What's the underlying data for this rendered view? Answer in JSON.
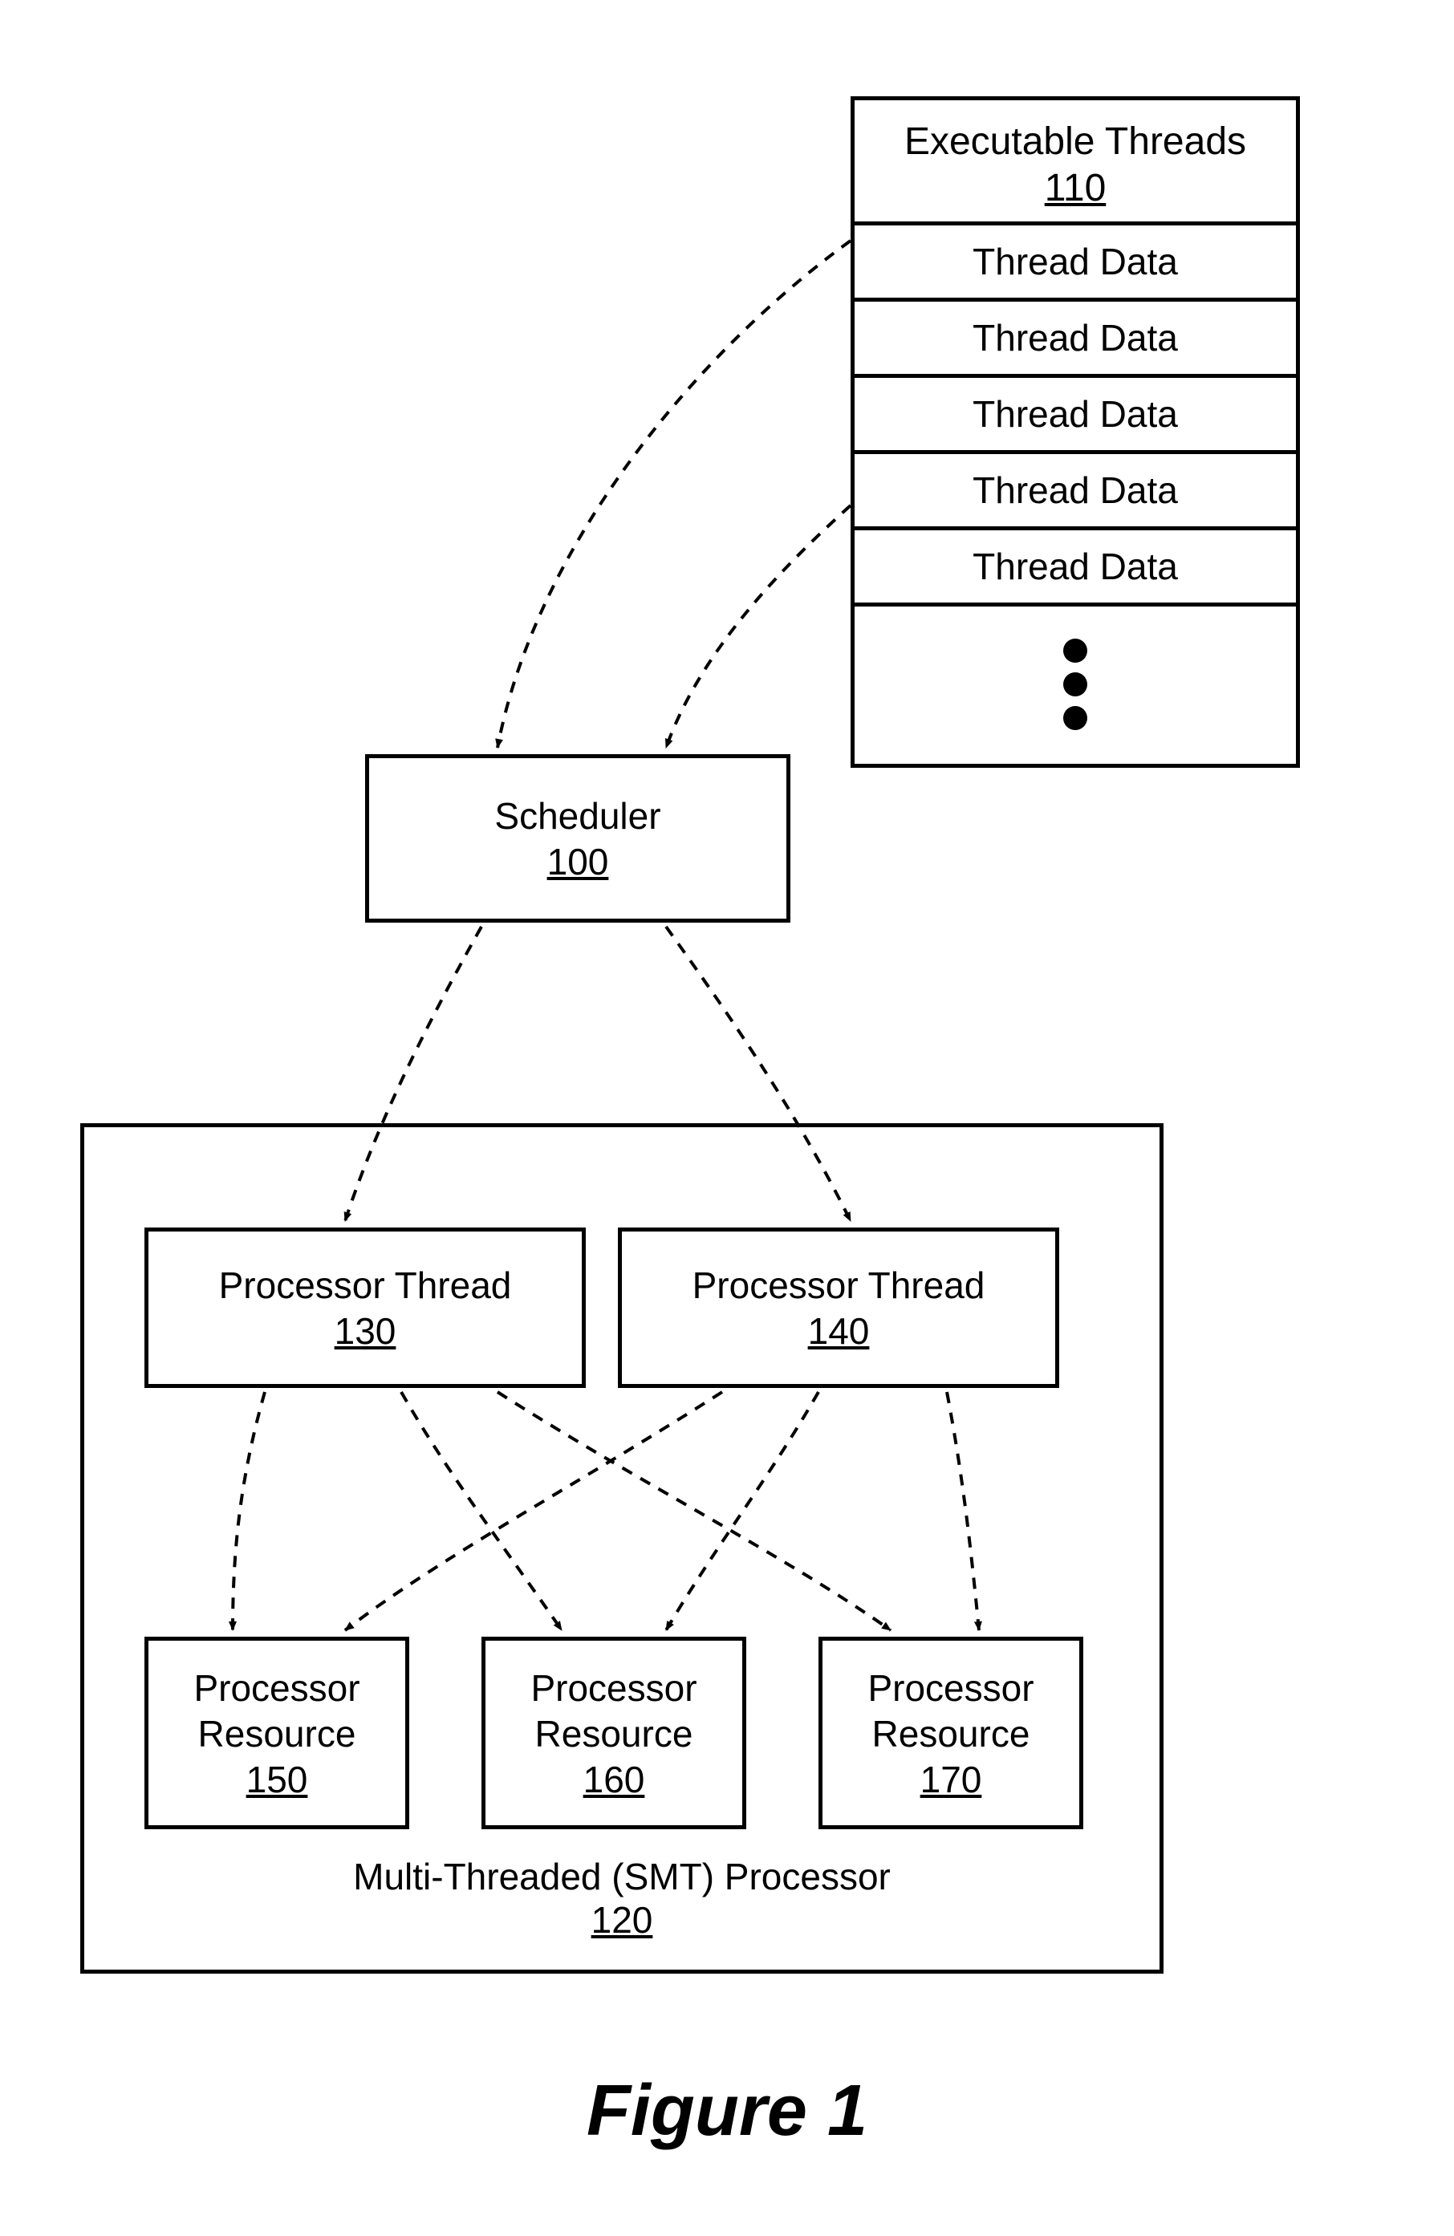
{
  "threads": {
    "title": "Executable Threads",
    "ref": "110",
    "rows": [
      "Thread Data",
      "Thread Data",
      "Thread Data",
      "Thread Data",
      "Thread Data"
    ]
  },
  "scheduler": {
    "label": "Scheduler",
    "ref": "100"
  },
  "smt": {
    "label": "Multi-Threaded (SMT) Processor",
    "ref": "120"
  },
  "pthread1": {
    "label": "Processor Thread",
    "ref": "130"
  },
  "pthread2": {
    "label": "Processor Thread",
    "ref": "140"
  },
  "pres1": {
    "label": "Processor\nResource",
    "ref": "150"
  },
  "pres2": {
    "label": "Processor\nResource",
    "ref": "160"
  },
  "pres3": {
    "label": "Processor\nResource",
    "ref": "170"
  },
  "figure": "Figure 1"
}
